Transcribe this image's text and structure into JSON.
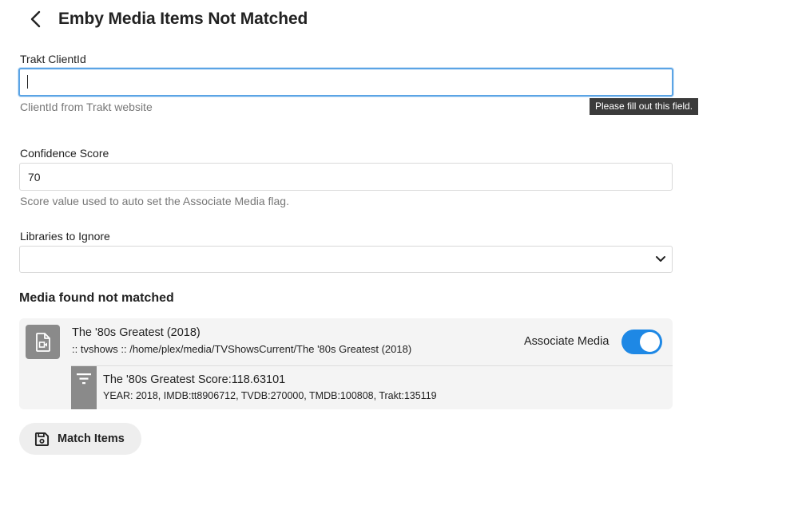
{
  "header": {
    "title": "Emby Media Items Not Matched",
    "back_icon": "chevron-left-icon"
  },
  "trakt_client_id": {
    "label": "Trakt ClientId",
    "value": "",
    "help": "ClientId from Trakt website",
    "validation_tooltip": "Please fill out this field."
  },
  "confidence_score": {
    "label": "Confidence Score",
    "value": "70",
    "help": "Score value used to auto set the Associate Media flag."
  },
  "libraries_to_ignore": {
    "label": "Libraries to Ignore",
    "selected": ""
  },
  "media_section": {
    "title": "Media found not matched",
    "items": [
      {
        "title": "The '80s Greatest (2018)",
        "path": ":: tvshows :: /home/plex/media/TVShowsCurrent/The '80s Greatest (2018)",
        "associate_label": "Associate Media",
        "associate_on": true,
        "match": {
          "title": "The '80s Greatest Score:118.63101",
          "ids": "YEAR: 2018, IMDB:tt8906712, TVDB:270000, TMDB:100808, Trakt:135119"
        }
      }
    ]
  },
  "actions": {
    "match_items_label": "Match Items",
    "match_items_icon": "save-icon"
  },
  "colors": {
    "accent": "#1e88e5",
    "focus_border": "#5ba4e5",
    "card_bg": "#f4f4f4",
    "icon_bg": "#8a8a8a"
  }
}
